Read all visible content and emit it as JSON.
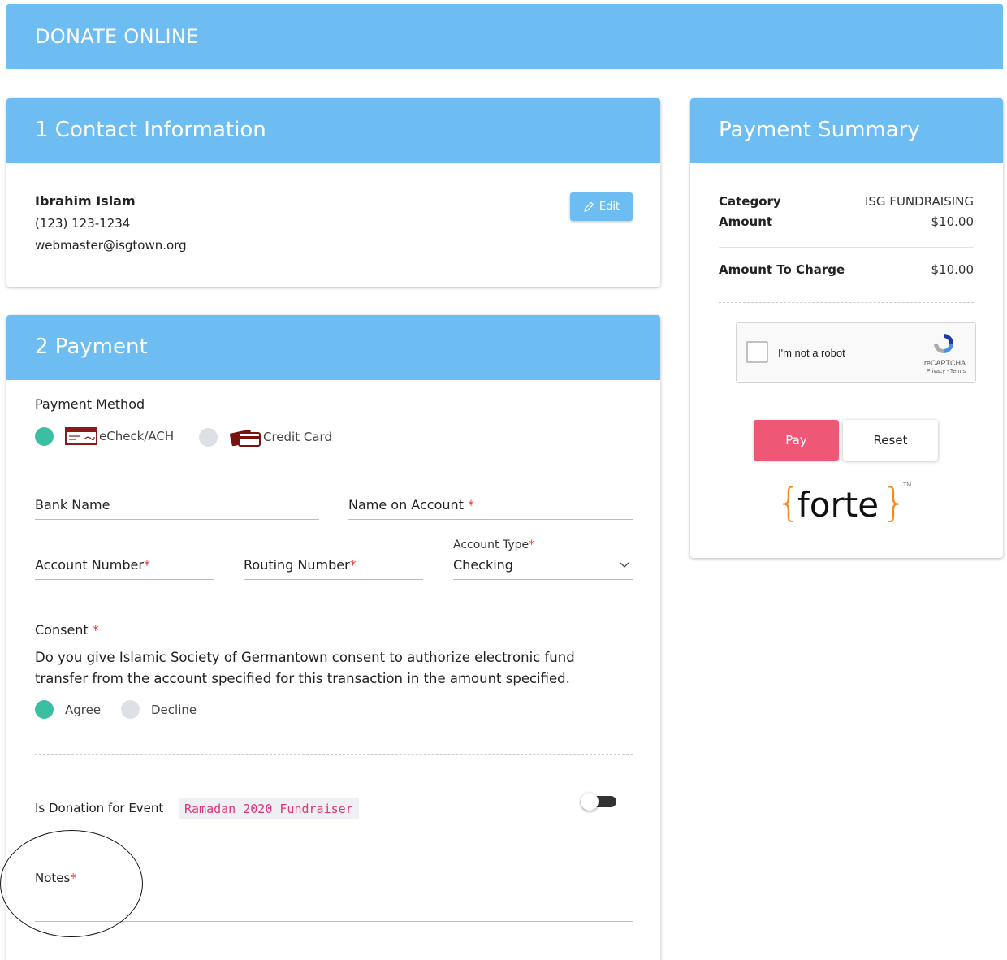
{
  "header": {
    "title": "DONATE ONLINE"
  },
  "contact": {
    "heading": "1 Contact Information",
    "name": "Ibrahim Islam",
    "phone": "(123) 123-1234",
    "email": "webmaster@isgtown.org",
    "edit_label": "Edit"
  },
  "payment": {
    "heading": "2 Payment",
    "method_label": "Payment Method",
    "methods": [
      {
        "label": "eCheck/ACH",
        "selected": true,
        "icon": "check-icon"
      },
      {
        "label": "Credit Card",
        "selected": false,
        "icon": "credit-card-icon"
      }
    ],
    "fields": {
      "bank_name": "Bank Name",
      "name_on_account": "Name on Account",
      "account_number": "Account Number",
      "routing_number": "Routing Number",
      "account_type_label": "Account Type",
      "account_type_value": "Checking"
    },
    "required_mark": "*",
    "consent": {
      "label": "Consent",
      "text": "Do you give Islamic Society of Germantown consent to authorize electronic fund transfer from the account specified for this transaction in the amount specified.",
      "options": [
        {
          "label": "Agree",
          "selected": true
        },
        {
          "label": "Decline",
          "selected": false
        }
      ]
    },
    "event": {
      "label": "Is Donation for Event",
      "tag": "Ramadan 2020 Fundraiser",
      "toggle_on": false
    },
    "notes_label": "Notes"
  },
  "summary": {
    "heading": "Payment Summary",
    "category_label": "Category",
    "category_value": "ISG FUNDRAISING",
    "amount_label": "Amount",
    "amount_value": "$10.00",
    "charge_label": "Amount To Charge",
    "charge_value": "$10.00",
    "captcha": {
      "label": "I'm not a robot",
      "brand": "reCAPTCHA",
      "links": "Privacy - Terms"
    },
    "pay_label": "Pay",
    "reset_label": "Reset",
    "logo": {
      "open": "{",
      "word": "forte",
      "close": "}",
      "tm": "TM"
    }
  },
  "colors": {
    "header_blue": "#6dbcf2",
    "selected_radio": "#3ac0a0",
    "pay_button": "#ef5777",
    "forte_orange": "#f28b1f"
  }
}
